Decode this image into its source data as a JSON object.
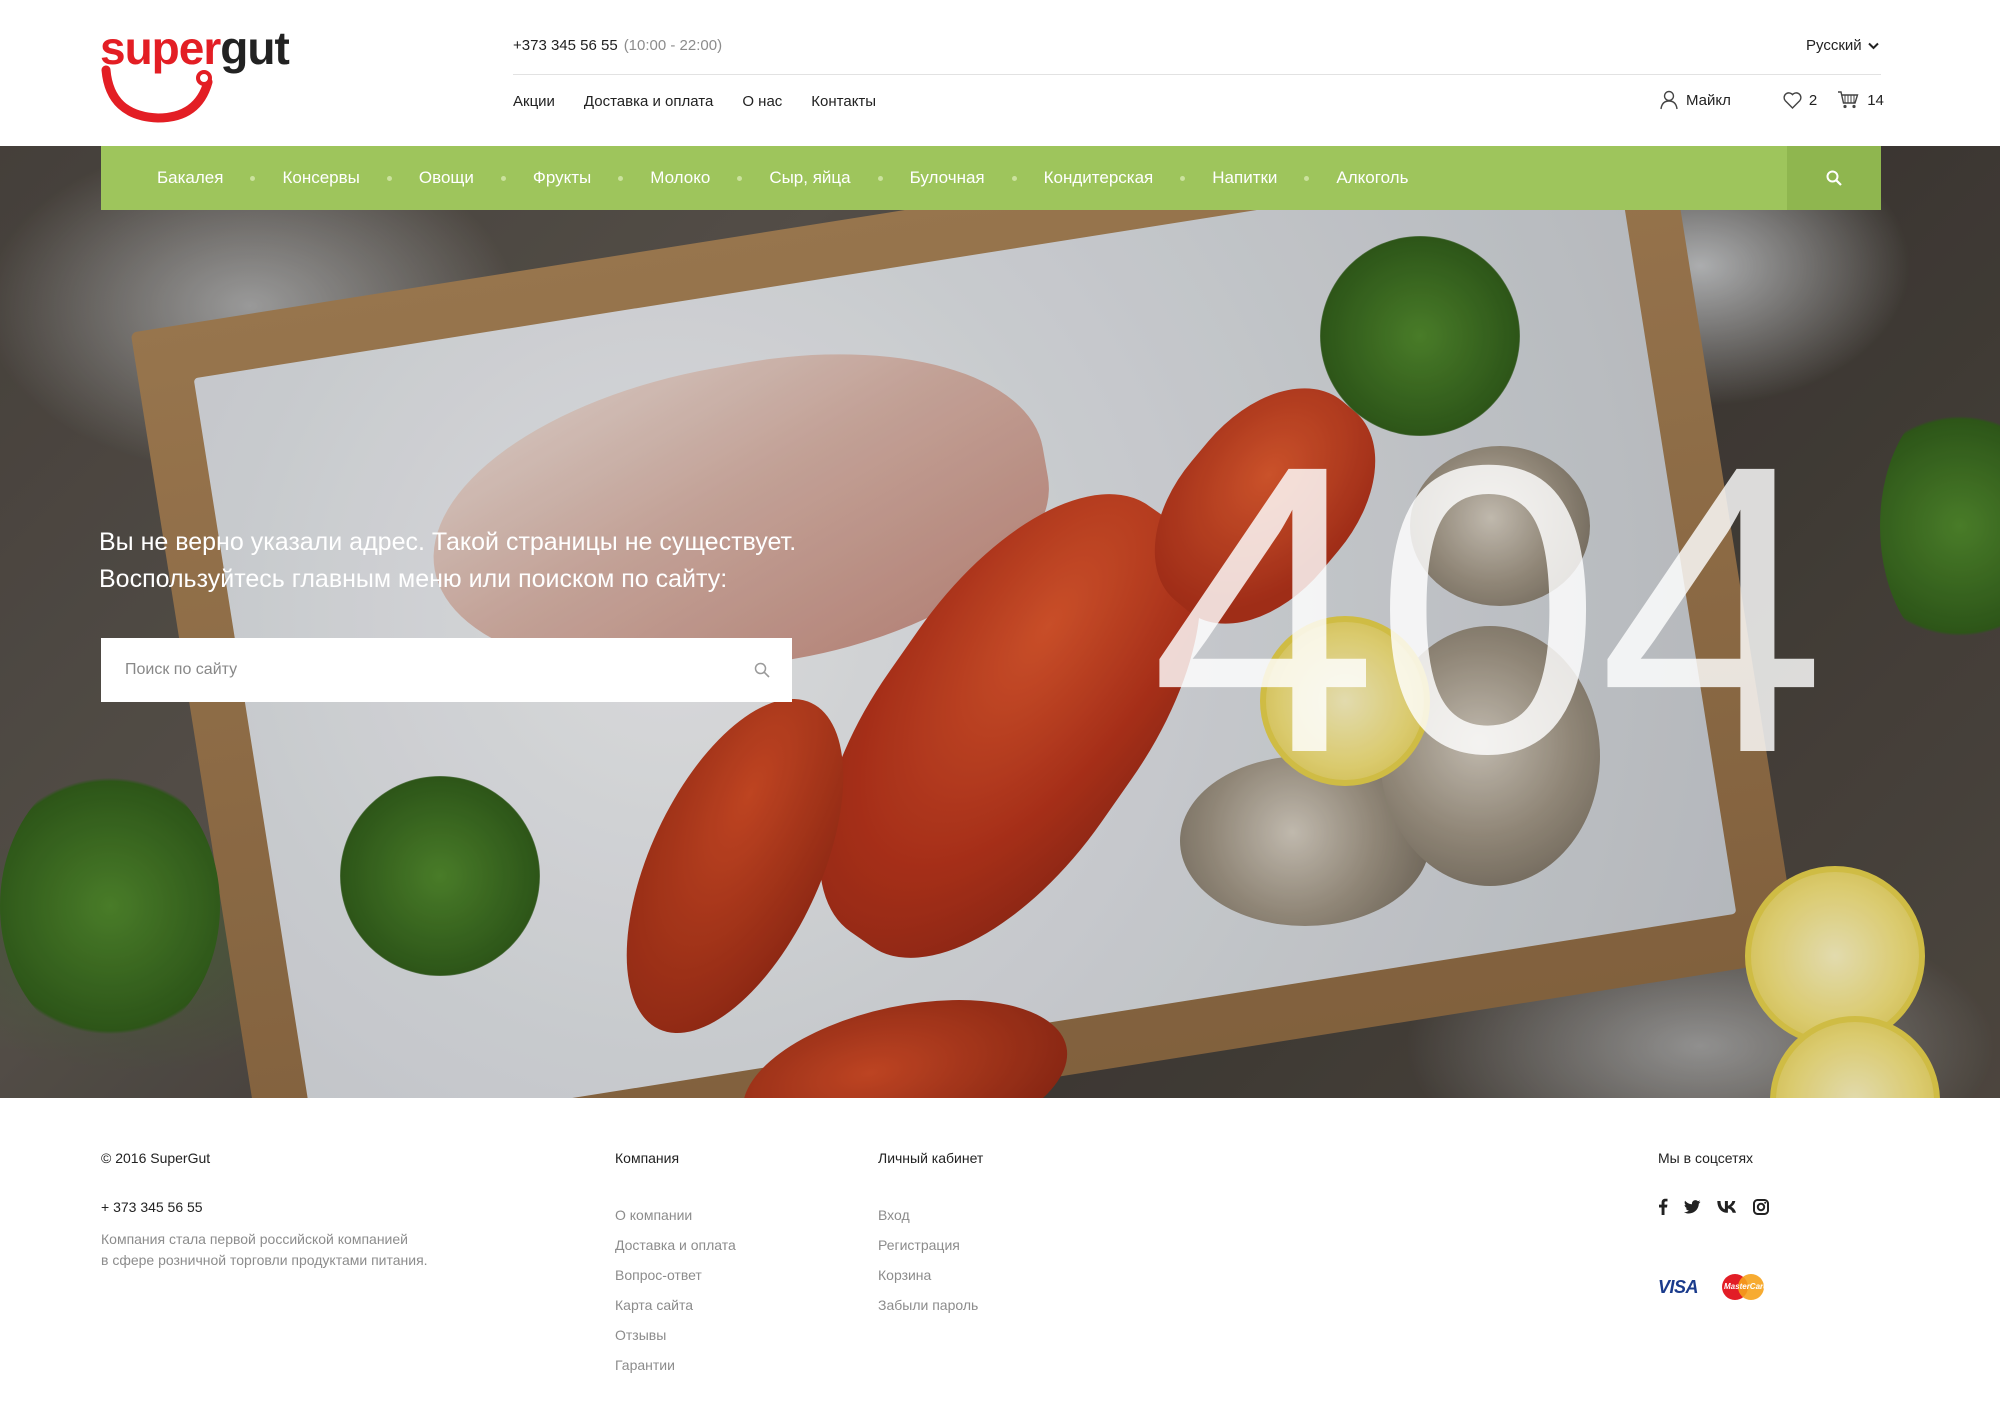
{
  "brand": {
    "part1": "super",
    "part2": "gut"
  },
  "header": {
    "phone": "+373 345 56 55",
    "hours": "(10:00 - 22:00)",
    "language": "Русский",
    "menu": [
      "Акции",
      "Доставка и оплата",
      "О нас",
      "Контакты"
    ],
    "user_name": "Майкл",
    "favorites_count": "2",
    "cart_count": "14"
  },
  "categories": [
    "Бакалея",
    "Консервы",
    "Овощи",
    "Фрукты",
    "Молоко",
    "Сыр, яйца",
    "Булочная",
    "Кондитерская",
    "Напитки",
    "Алкоголь"
  ],
  "hero": {
    "error_code": "404",
    "message_line1": "Вы не верно указали адрес. Такой страницы не существует.",
    "message_line2": "Воспользуйтесь главным меню или поиском по сайту:",
    "search_placeholder": "Поиск по сайту"
  },
  "footer": {
    "copyright": "© 2016 SuperGut",
    "phone": "+ 373 345 56 55",
    "description_line1": "Компания стала первой российской компанией",
    "description_line2": "в сфере розничной торговли продуктами питания.",
    "company_title": "Компания",
    "company_links": [
      "О компании",
      "Доставка и оплата",
      "Вопрос-ответ",
      "Карта сайта",
      "Отзывы",
      "Гарантии"
    ],
    "account_title": "Личный кабинет",
    "account_links": [
      "Вход",
      "Регистрация",
      "Корзина",
      "Забыли пароль"
    ],
    "social_title": "Мы в соцсетях",
    "social_icons": [
      "facebook-icon",
      "twitter-icon",
      "vk-icon",
      "instagram-icon"
    ],
    "payments": {
      "visa": "VISA",
      "mastercard": "MasterCard"
    }
  },
  "colors": {
    "brand_red": "#e31e24",
    "category_bar": "#9ec55c",
    "category_search": "#8fb64f"
  }
}
